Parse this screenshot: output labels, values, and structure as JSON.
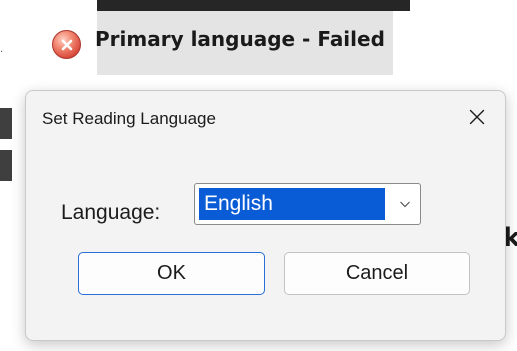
{
  "background": {
    "status_text": "Primary language - Failed",
    "status_icon": "error-icon",
    "tick_text": ".",
    "tail_text": "k"
  },
  "dialog": {
    "title": "Set Reading Language",
    "close_icon": "close-icon",
    "language_label": "Language:",
    "language_selected": "English",
    "dropdown_icon": "chevron-down-icon",
    "ok_label": "OK",
    "cancel_label": "Cancel"
  },
  "colors": {
    "accent": "#0a5cd6",
    "dialog_bg": "#f3f3f3",
    "error": "#d9473a"
  }
}
